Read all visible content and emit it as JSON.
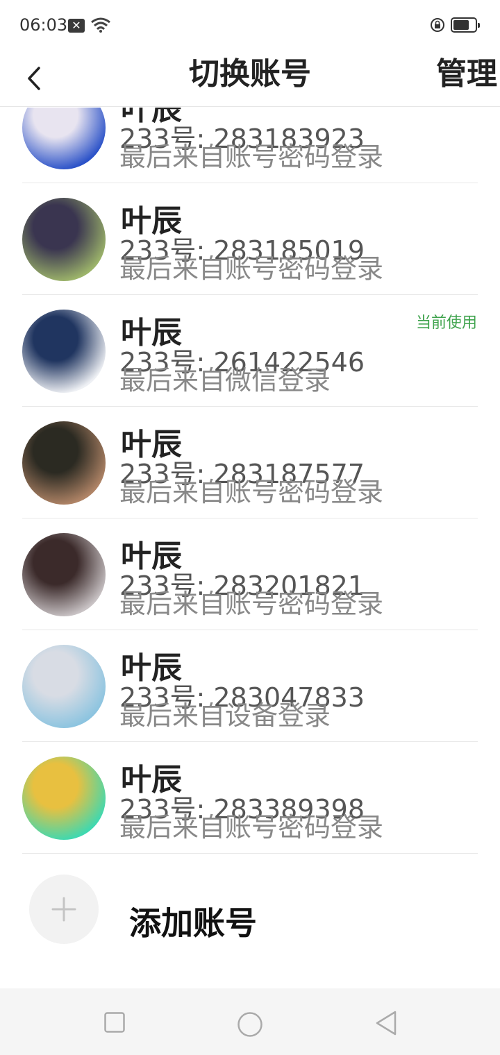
{
  "status_bar": {
    "time": "06:03"
  },
  "header": {
    "title": "切换账号",
    "manage_label": "管理"
  },
  "accounts": [
    {
      "name": "叶辰",
      "id_text": "233号: 283183923",
      "login_text": "最后来自账号密码登录",
      "current": false,
      "avatar_colors": [
        "#2b52c8",
        "#e8e4f0"
      ]
    },
    {
      "name": "叶辰",
      "id_text": "233号: 283185019",
      "login_text": "最后来自账号密码登录",
      "current": false,
      "avatar_colors": [
        "#9cb46a",
        "#3a3550"
      ]
    },
    {
      "name": "叶辰",
      "id_text": "233号: 261422546",
      "login_text": "最后来自微信登录",
      "current": true,
      "current_label": "当前使用",
      "avatar_colors": [
        "#eef0f4",
        "#203560"
      ]
    },
    {
      "name": "叶辰",
      "id_text": "233号: 283187577",
      "login_text": "最后来自账号密码登录",
      "current": false,
      "avatar_colors": [
        "#b08466",
        "#2b2a22"
      ]
    },
    {
      "name": "叶辰",
      "id_text": "233号: 283201821",
      "login_text": "最后来自账号密码登录",
      "current": false,
      "avatar_colors": [
        "#c8c2c4",
        "#3b2a2a"
      ]
    },
    {
      "name": "叶辰",
      "id_text": "233号: 283047833",
      "login_text": "最后来自设备登录",
      "current": false,
      "avatar_colors": [
        "#8cc4e0",
        "#d8dce4"
      ]
    },
    {
      "name": "叶辰",
      "id_text": "233号: 283389398",
      "login_text": "最后来自账号密码登录",
      "current": false,
      "avatar_colors": [
        "#3fd8b0",
        "#e8c040"
      ]
    }
  ],
  "add_account": {
    "label": "添加账号"
  },
  "colors": {
    "accent_green": "#3fa34d",
    "divider": "#e8e8e8"
  }
}
